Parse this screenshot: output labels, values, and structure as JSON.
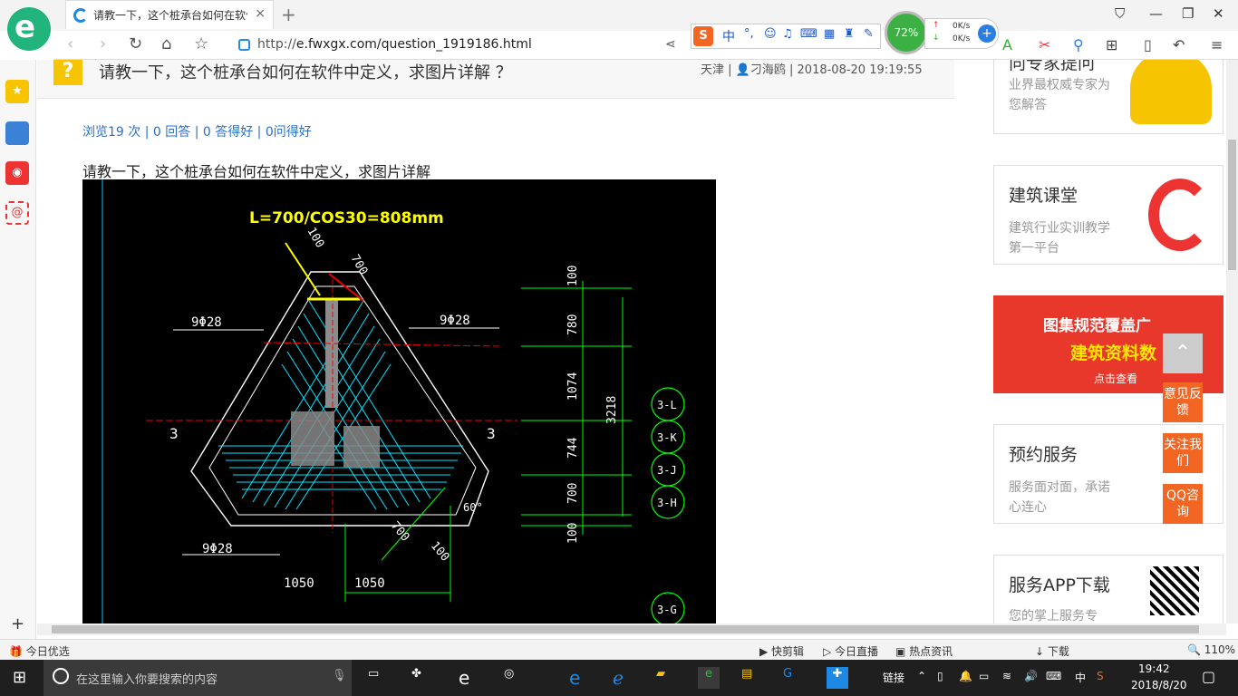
{
  "browser": {
    "tab_title": "请教一下，这个桩承台如何在软件中定义",
    "tab_close": "×",
    "new_tab": "+",
    "url_prefix": "http://",
    "url_main": "e.fwxgx.com/question_1919186.html",
    "ime_label": "中",
    "gauge": "72%",
    "upload_speed": "0K/s",
    "download_speed": "0K/s"
  },
  "question": {
    "title": "请教一下，这个桩承台如何在软件中定义，求图片详解 ？",
    "meta_location": "天津",
    "meta_user": "刁海鸥",
    "meta_time": "2018-08-20 19:19:55",
    "stats": "浏览19 次 | 0 回答 | 0 答得好 | 0问得好",
    "body": "请教一下，这个桩承台如何在软件中定义，求图片详解"
  },
  "cad": {
    "formula": "L=700/COS30=808mm",
    "rebar_a": "9Φ28",
    "rebar_b": "9Φ28",
    "rebar_c": "9Φ28",
    "dim_700_top": "700",
    "dim_100_top": "100",
    "dim_3218": "3218",
    "dims_right": [
      "100",
      "780",
      "1074",
      "744",
      "700",
      "100"
    ],
    "dim_1050_left": "1050",
    "dim_1050_right": "1050",
    "dim_700_bottom": "700",
    "dim_100_bottom": "100",
    "angle": "60°",
    "section_left": "3",
    "section_right": "3",
    "axes": [
      "3-L",
      "3-K",
      "3-J",
      "3-H",
      "3-G"
    ]
  },
  "sidebar": {
    "cards": [
      {
        "title": "向专家提问",
        "desc": "业界最权威专家为您解答"
      },
      {
        "title": "建筑课堂",
        "desc": "建筑行业实训教学第一平台"
      },
      {
        "title": "图集规范覆盖广",
        "desc": "建筑资料数",
        "cta": "点击查看"
      },
      {
        "title": "预约服务",
        "desc": "服务面对面，承诺心连心"
      },
      {
        "title": "服务APP下载",
        "desc": "您的掌上服务专"
      }
    ],
    "float_buttons": [
      "意见反馈",
      "关注我们",
      "QQ咨询"
    ]
  },
  "statusbar": {
    "left": "今日优选",
    "items": [
      "快剪辑",
      "今日直播",
      "热点资讯"
    ],
    "download": "下载",
    "zoom": "110%"
  },
  "taskbar": {
    "search_placeholder": "在这里输入你要搜索的内容",
    "link_label": "链接",
    "ime": "中",
    "time": "19:42",
    "date": "2018/8/20"
  },
  "colors": {
    "accent": "#2a6fc9",
    "orange": "#f26522",
    "cad_bg": "#000000",
    "yellow": "#ffff00",
    "cyan": "#00e5ff",
    "green": "#00ff00"
  }
}
